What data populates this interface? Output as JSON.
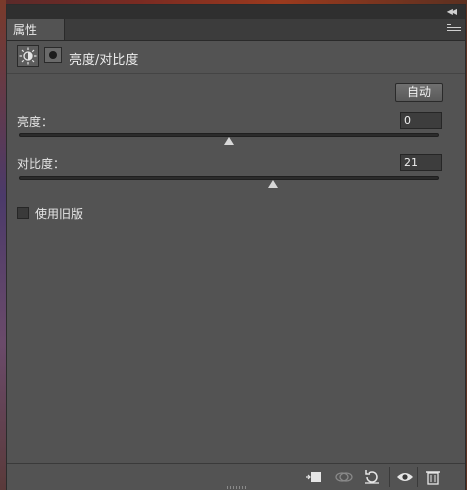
{
  "panel": {
    "tab_label": "属性",
    "header_title": "亮度/对比度"
  },
  "controls": {
    "auto_label": "自动",
    "brightness": {
      "label": "亮度：",
      "value": "0",
      "slider_fraction": 0.5
    },
    "contrast": {
      "label": "对比度：",
      "value": "21",
      "slider_fraction": 0.6
    },
    "legacy": {
      "label": "使用旧版",
      "checked": false
    }
  },
  "icons": {
    "title": [
      "collapse-icon",
      "menu-icon"
    ],
    "header": [
      "brightness-contrast-adjustment-icon",
      "layer-mask-icon"
    ],
    "footer": [
      "clip-to-layer-icon",
      "view-previous-state-icon",
      "reset-icon",
      "visibility-icon",
      "delete-icon"
    ]
  }
}
